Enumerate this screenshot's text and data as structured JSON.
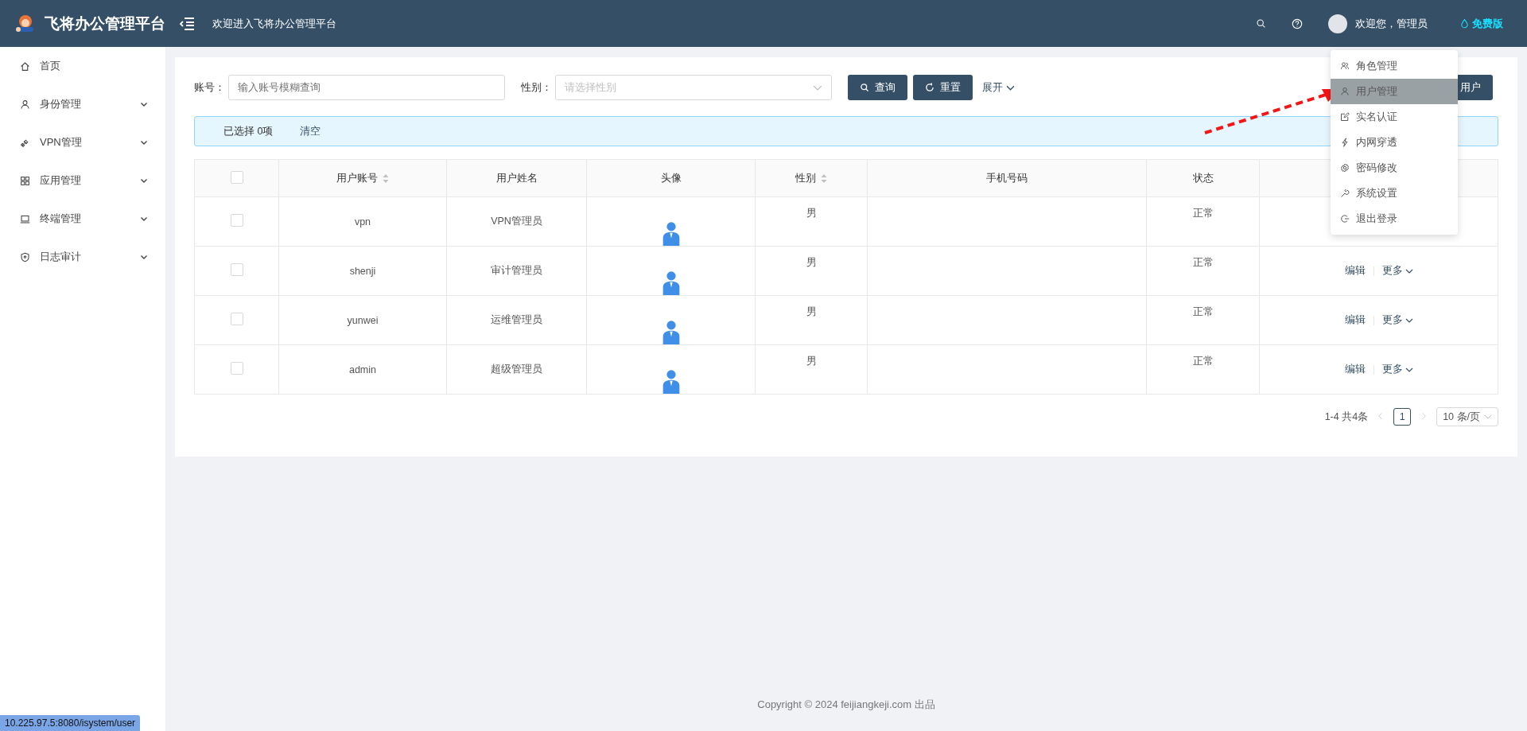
{
  "header": {
    "brand": "飞将办公管理平台",
    "welcome": "欢迎进入飞将办公管理平台",
    "user_greeting": "欢迎您，管理员",
    "edition": "免费版"
  },
  "sidebar": {
    "items": [
      {
        "label": "首页",
        "selected": false
      },
      {
        "label": "身份管理",
        "selected": false,
        "expanded": false
      },
      {
        "label": "VPN管理",
        "selected": false,
        "expanded": false
      },
      {
        "label": "应用管理",
        "selected": false,
        "expanded": false
      },
      {
        "label": "终端管理",
        "selected": false,
        "expanded": false
      },
      {
        "label": "日志审计",
        "selected": false,
        "expanded": false
      }
    ]
  },
  "search": {
    "account_label": "账号：",
    "account_placeholder": "输入账号模糊查询",
    "gender_label": "性别：",
    "gender_placeholder": "请选择性别",
    "query_button": "查询",
    "reset_button": "重置",
    "expand_link": "展开",
    "add_button": "用户"
  },
  "selection": {
    "text": "已选择 0项",
    "clear": "清空"
  },
  "table": {
    "select_all": false,
    "columns": [
      {
        "label": "用户账号",
        "sortable": true
      },
      {
        "label": "用户姓名",
        "sortable": false
      },
      {
        "label": "头像",
        "sortable": false
      },
      {
        "label": "性别",
        "sortable": true
      },
      {
        "label": "手机号码",
        "sortable": false
      },
      {
        "label": "状态",
        "sortable": false
      }
    ],
    "rows": [
      {
        "checked": false,
        "account": "vpn",
        "name": "VPN管理员",
        "gender": "男",
        "status": "正常"
      },
      {
        "checked": false,
        "account": "shenji",
        "name": "审计管理员",
        "gender": "男",
        "status": "正常",
        "edit": "编辑",
        "more": "更多"
      },
      {
        "checked": false,
        "account": "yunwei",
        "name": "运维管理员",
        "gender": "男",
        "status": "正常",
        "edit": "编辑",
        "more": "更多"
      },
      {
        "checked": false,
        "account": "admin",
        "name": "超级管理员",
        "gender": "男",
        "status": "正常",
        "edit": "编辑",
        "more": "更多"
      }
    ]
  },
  "pagination": {
    "total": "1-4 共4条",
    "pages": [
      {
        "label": "1",
        "selected": true
      }
    ],
    "page_size": "10 条/页"
  },
  "dropdown": {
    "items": [
      {
        "label": "角色管理",
        "selected": false
      },
      {
        "label": "用户管理",
        "selected": true
      },
      {
        "label": "实名认证",
        "selected": false
      },
      {
        "label": "内网穿透",
        "selected": false
      },
      {
        "label": "密码修改",
        "selected": false
      },
      {
        "label": "系统设置",
        "selected": false
      },
      {
        "label": "退出登录",
        "selected": false
      }
    ]
  },
  "footer": {
    "copyright": "Copyright © 2024 feijiangkeji.com 出品"
  },
  "status_url": "10.225.97.5:8080/isystem/user"
}
